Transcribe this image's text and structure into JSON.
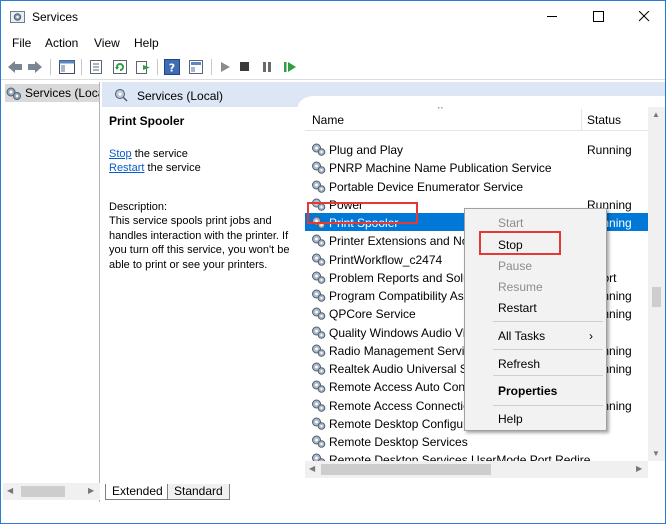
{
  "window": {
    "title": "Services",
    "app_icon": "gear-icon"
  },
  "menubar": [
    "File",
    "Action",
    "View",
    "Help"
  ],
  "toolbar": {
    "icons": [
      "back-icon",
      "forward-icon",
      "show-hide-tree-icon",
      "properties-icon",
      "refresh-icon",
      "export-icon",
      "help-icon",
      "snapin-icon",
      "play-icon",
      "stop-icon",
      "pause-icon",
      "restart-icon"
    ]
  },
  "tree": {
    "item": "Services (Local)"
  },
  "header": {
    "title": "Services (Local)"
  },
  "detail": {
    "service_name": "Print Spooler",
    "stop_link": "Stop",
    "stop_suffix": " the service",
    "restart_link": "Restart",
    "restart_suffix": " the service",
    "description_label": "Description:",
    "description": "This service spools print jobs and handles interaction with the printer. If you turn off this service, you won't be able to print or see your printers."
  },
  "columns": {
    "name": "Name",
    "status": "Status"
  },
  "services": [
    {
      "name": "Plug and Play",
      "status": "Running"
    },
    {
      "name": "PNRP Machine Name Publication Service",
      "status": ""
    },
    {
      "name": "Portable Device Enumerator Service",
      "status": ""
    },
    {
      "name": "Power",
      "status": "Running"
    },
    {
      "name": "Print Spooler",
      "status": "Running",
      "selected": true
    },
    {
      "name": "Printer Extensions and Notifications",
      "status": ""
    },
    {
      "name": "PrintWorkflow_c2474",
      "status": ""
    },
    {
      "name": "Problem Reports and Solutions Control Panel Support",
      "status": ""
    },
    {
      "name": "Program Compatibility Assistant Service",
      "status": "Running"
    },
    {
      "name": "QPCore Service",
      "status": "Running"
    },
    {
      "name": "Quality Windows Audio Video Experience",
      "status": ""
    },
    {
      "name": "Radio Management Service",
      "status": "Running"
    },
    {
      "name": "Realtek Audio Universal Service",
      "status": "Running"
    },
    {
      "name": "Remote Access Auto Connection Manager",
      "status": ""
    },
    {
      "name": "Remote Access Connection Manager",
      "status": "Running"
    },
    {
      "name": "Remote Desktop Configuration",
      "status": ""
    },
    {
      "name": "Remote Desktop Services",
      "status": ""
    },
    {
      "name": "Remote Desktop Services UserMode Port Redire...",
      "status": ""
    }
  ],
  "context_menu": {
    "items": [
      {
        "label": "Start",
        "disabled": true
      },
      {
        "label": "Stop",
        "disabled": false
      },
      {
        "label": "Pause",
        "disabled": true
      },
      {
        "label": "Resume",
        "disabled": true
      },
      {
        "label": "Restart",
        "disabled": false
      },
      {
        "label": "All Tasks",
        "disabled": false,
        "submenu": true
      },
      {
        "label": "Refresh",
        "disabled": false
      },
      {
        "label": "Properties",
        "disabled": false,
        "bold": true
      },
      {
        "label": "Help",
        "disabled": false
      }
    ]
  },
  "tabs": [
    "Extended",
    "Standard"
  ],
  "colors": {
    "selection": "#0078d7",
    "highlight": "#e53935",
    "link": "#0b5ccc",
    "header_band": "#dce6f4"
  }
}
